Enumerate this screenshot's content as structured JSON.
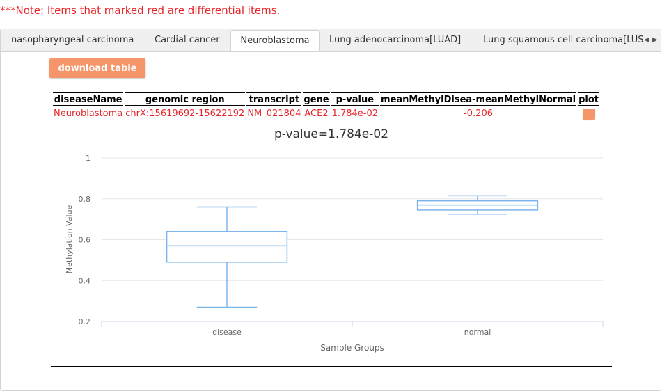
{
  "note": "***Note: Items that marked red are differential items.",
  "tabs": [
    {
      "label": "nasopharyngeal carcinoma",
      "active": false
    },
    {
      "label": "Cardial cancer",
      "active": false
    },
    {
      "label": "Neuroblastoma",
      "active": true
    },
    {
      "label": "Lung adenocarcinoma[LUAD]",
      "active": false
    },
    {
      "label": "Lung squamous cell carcinoma[LUSC]",
      "active": false
    }
  ],
  "scroll_left": "◀",
  "scroll_right": "▶",
  "download_label": "download table",
  "table": {
    "headers": [
      "diseaseName",
      "genomic region",
      "transcript",
      "gene",
      "p-value",
      "meanMethylDisea-meanMethylNormal",
      "plot"
    ],
    "rows": [
      [
        "Neuroblastoma",
        "chrX:15619692-15622192",
        "NM_021804",
        "ACE2",
        "1.784e-02",
        "-0.206",
        "−"
      ]
    ]
  },
  "colors": {
    "differential_text": "#e8262a",
    "button": "#f7956a",
    "box_stroke": "#7cb5ec"
  },
  "chart_data": {
    "type": "boxplot",
    "title": "p-value=1.784e-02",
    "xlabel": "Sample Groups",
    "ylabel": "Methylation Value",
    "ylim": [
      0.2,
      1
    ],
    "yticks": [
      "0.2",
      "0.4",
      "0.6",
      "0.8",
      "1"
    ],
    "categories": [
      "disease",
      "normal"
    ],
    "boxes": [
      {
        "category": "disease",
        "min": 0.27,
        "q1": 0.49,
        "median": 0.57,
        "q3": 0.64,
        "max": 0.76
      },
      {
        "category": "normal",
        "min": 0.725,
        "q1": 0.745,
        "median": 0.77,
        "q3": 0.79,
        "max": 0.815
      }
    ],
    "grid": true,
    "legend": "none"
  }
}
